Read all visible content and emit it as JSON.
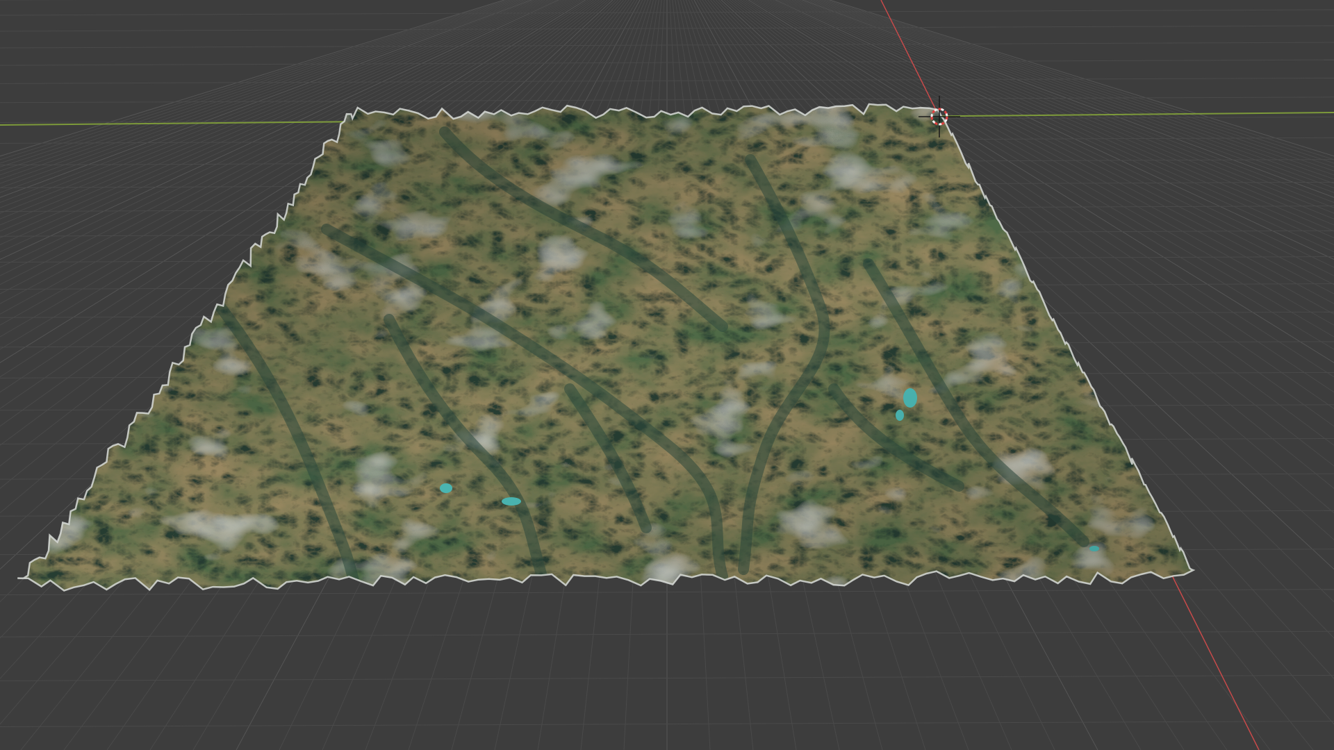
{
  "app": {
    "editor": "3d-viewport",
    "colors": {
      "background": "#3d3d3d",
      "grid_line": "#4a4a4a",
      "grid_line_major": "#555555",
      "x_axis": "#c84a4a",
      "y_axis": "#7d9a3a",
      "cursor_red": "#e04040",
      "cursor_white": "#f0f0f0",
      "terrain_green": "#5a7348",
      "terrain_dark": "#2e4a3e",
      "terrain_tan": "#9c8a62",
      "terrain_snow": "#c8ccc8",
      "terrain_lake": "#4bb8b4",
      "terrain_edge": "#d8dcd8"
    },
    "scene_objects": [
      {
        "name": "terrain-mesh",
        "icon": "mesh-icon"
      },
      {
        "name": "3d-cursor",
        "icon": "crosshair-icon"
      }
    ]
  }
}
